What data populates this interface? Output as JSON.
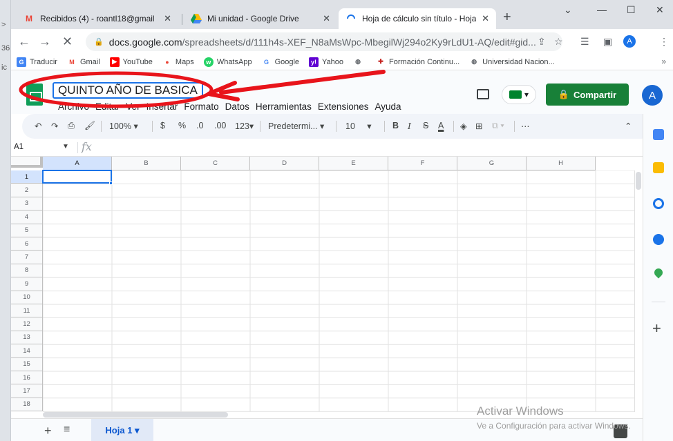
{
  "left_strip": {
    "chars": [
      ">",
      "36",
      "ic"
    ]
  },
  "browser": {
    "tabs": [
      {
        "label": "Recibidos (4) - roantl18@gmail",
        "icon": "gmail-icon",
        "close": "✕"
      },
      {
        "label": "Mi unidad - Google Drive",
        "icon": "drive-icon",
        "close": "✕"
      },
      {
        "label": "Hoja de cálculo sin título - Hoja",
        "icon": "loading-icon",
        "close": "✕"
      }
    ],
    "new_tab": "+",
    "window_controls": {
      "dropdown": "⌄",
      "minimize": "—",
      "maximize": "☐",
      "close": "✕"
    },
    "url_domain": "docs.google.com",
    "url_path": "/spreadsheets/d/111h4s-XEF_N8aMsWpc-MbegilWj294o2Ky9rLdU1-AQ/edit#gid...",
    "profile_initial": "A",
    "bookmarks": [
      {
        "label": "Traducir",
        "icon": "translate-icon",
        "color": "#4285f4"
      },
      {
        "label": "Gmail",
        "icon": "gmail-icon",
        "color": "#ea4335"
      },
      {
        "label": "YouTube",
        "icon": "youtube-icon",
        "color": "#ff0000"
      },
      {
        "label": "Maps",
        "icon": "maps-icon",
        "color": "#34a853"
      },
      {
        "label": "WhatsApp",
        "icon": "whatsapp-icon",
        "color": "#25d366"
      },
      {
        "label": "Google",
        "icon": "google-icon",
        "color": "#4285f4"
      },
      {
        "label": "Yahoo",
        "icon": "yahoo-icon",
        "color": "#6001d2"
      },
      {
        "label": "",
        "icon": "globe-icon",
        "color": "#5f6368"
      },
      {
        "label": "Formación Continu...",
        "icon": "formacion-icon",
        "color": "#c5221f"
      },
      {
        "label": "Universidad Nacion...",
        "icon": "globe-icon",
        "color": "#5f6368"
      }
    ],
    "bookmarks_more": "»"
  },
  "sheets": {
    "title": "QUINTO AÑO DE BASICA",
    "menu": [
      "Archivo",
      "Editar",
      "Ver",
      "Insertar",
      "Formato",
      "Datos",
      "Herramientas",
      "Extensiones",
      "Ayuda"
    ],
    "share_label": "Compartir",
    "avatar_initial": "A",
    "toolbar": {
      "zoom": "100%",
      "currency": "$",
      "percent": "%",
      "dec_less": ".0",
      "dec_more": ".00",
      "num_format": "123",
      "font": "Predetermi...",
      "font_size": "10",
      "bold": "B",
      "italic": "I",
      "strike": "S",
      "text_color": "A",
      "more": "⋯",
      "collapse": "⌃"
    },
    "name_box": "A1",
    "fx": "fx",
    "columns": [
      "A",
      "B",
      "C",
      "D",
      "E",
      "F",
      "G",
      "H"
    ],
    "rows": [
      "1",
      "2",
      "3",
      "4",
      "5",
      "6",
      "7",
      "8",
      "9",
      "10",
      "11",
      "12",
      "13",
      "14",
      "15",
      "16",
      "17",
      "18"
    ],
    "active_cell": "A1",
    "sheet_tab": "Hoja 1",
    "add_sheet": "+",
    "list_sheets": "≡"
  },
  "watermark": {
    "line1": "Activar Windows",
    "line2": "Ve a Configuración para activar Windows."
  },
  "colors": {
    "accent": "#1a73e8",
    "share_green": "#188038",
    "annotation_red": "#e8141b"
  }
}
